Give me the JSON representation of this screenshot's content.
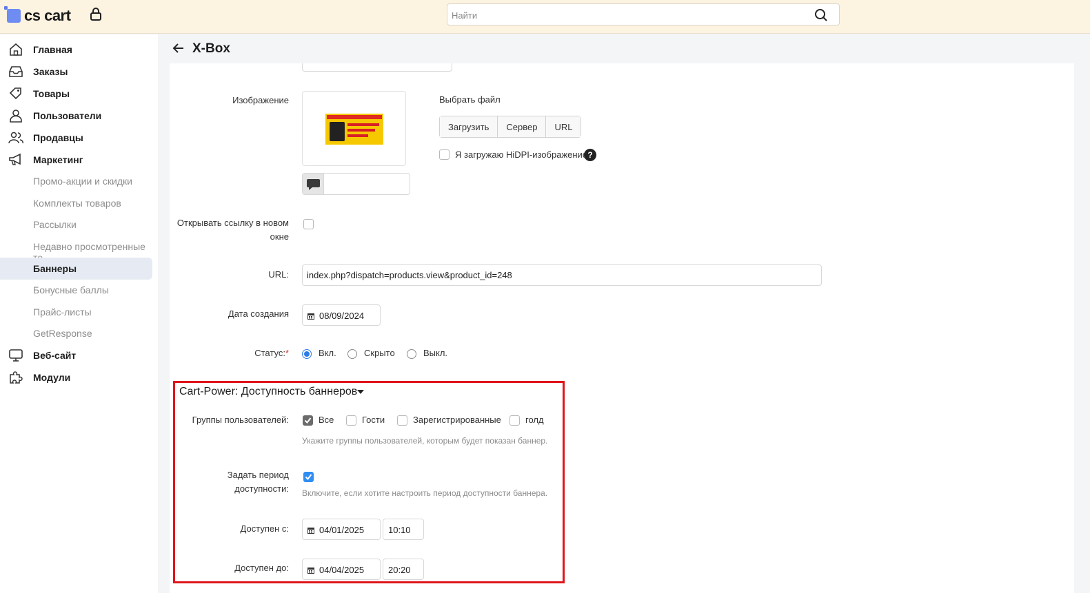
{
  "app": {
    "logo_text": "cs cart"
  },
  "search": {
    "placeholder": "Найти"
  },
  "sidebar": {
    "items": [
      {
        "label": "Главная",
        "icon": "home-icon",
        "type": "main"
      },
      {
        "label": "Заказы",
        "icon": "inbox-icon",
        "type": "main"
      },
      {
        "label": "Товары",
        "icon": "tag-icon",
        "type": "main"
      },
      {
        "label": "Пользователи",
        "icon": "user-icon",
        "type": "main"
      },
      {
        "label": "Продавцы",
        "icon": "users-icon",
        "type": "main"
      },
      {
        "label": "Маркетинг",
        "icon": "megaphone-icon",
        "type": "main"
      },
      {
        "label": "Промо-акции и скидки",
        "type": "sub"
      },
      {
        "label": "Комплекты товаров",
        "type": "sub"
      },
      {
        "label": "Рассылки",
        "type": "sub"
      },
      {
        "label": "Недавно просмотренные то...",
        "type": "sub"
      },
      {
        "label": "Баннеры",
        "type": "sub",
        "active": true
      },
      {
        "label": "Бонусные баллы",
        "type": "sub"
      },
      {
        "label": "Прайс-листы",
        "type": "sub"
      },
      {
        "label": "GetResponse",
        "type": "sub"
      },
      {
        "label": "Веб-сайт",
        "icon": "monitor-icon",
        "type": "main"
      },
      {
        "label": "Модули",
        "icon": "puzzle-icon",
        "type": "main"
      }
    ]
  },
  "page": {
    "title": "X-Box"
  },
  "form": {
    "image_label": "Изображение",
    "pick_file_label": "Выбрать файл",
    "upload_buttons": [
      "Загрузить",
      "Сервер",
      "URL"
    ],
    "hidpi_label": "Я загружаю HiDPI-изображение.",
    "help_glyph": "?",
    "open_new_window_label": "Открывать ссылку в новом окне",
    "url_label": "URL:",
    "url_value": "index.php?dispatch=products.view&product_id=248",
    "created_label": "Дата создания",
    "created_value": "08/09/2024",
    "status_label": "Статус:",
    "status_required_mark": "*",
    "status_options": [
      "Вкл.",
      "Скрыто",
      "Выкл."
    ],
    "status_selected": "Вкл."
  },
  "availability": {
    "title": "Cart-Power: Доступность баннеров",
    "groups_label": "Группы пользователей:",
    "groups": [
      {
        "label": "Все",
        "checked": true
      },
      {
        "label": "Гости",
        "checked": false
      },
      {
        "label": "Зарегистрированные",
        "checked": false
      },
      {
        "label": "голд",
        "checked": false
      }
    ],
    "groups_hint": "Укажите группы пользователей, которым будет показан баннер.",
    "period_label": "Задать период доступности:",
    "period_enabled": true,
    "period_hint": "Включите, если хотите настроить период доступности баннера.",
    "from_label": "Доступен с:",
    "from_date": "04/01/2025",
    "from_time": "10:10",
    "to_label": "Доступен до:",
    "to_date": "04/04/2025",
    "to_time": "20:20"
  },
  "colors": {
    "accent": "#2f8df3",
    "highlight_box": "#e0141b",
    "topbar": "#fdf3e1"
  }
}
